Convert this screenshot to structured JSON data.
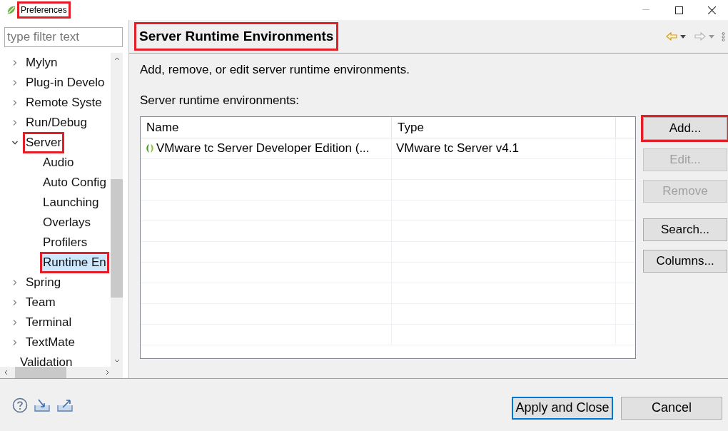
{
  "window": {
    "title": "Preferences",
    "highlighted": true
  },
  "filter": {
    "placeholder": "type filter text"
  },
  "tree": [
    {
      "label": "Mylyn",
      "expanded": false,
      "selected": false,
      "highlighted": false
    },
    {
      "label": "Plug-in Develo",
      "expanded": false,
      "selected": false,
      "highlighted": false
    },
    {
      "label": "Remote Syste",
      "expanded": false,
      "selected": false,
      "highlighted": false
    },
    {
      "label": "Run/Debug",
      "expanded": false,
      "selected": false,
      "highlighted": false
    },
    {
      "label": "Server",
      "expanded": true,
      "selected": false,
      "highlighted": true,
      "children": [
        {
          "label": "Audio",
          "selected": false,
          "highlighted": false
        },
        {
          "label": "Auto Config",
          "selected": false,
          "highlighted": false
        },
        {
          "label": "Launching",
          "selected": false,
          "highlighted": false
        },
        {
          "label": "Overlays",
          "selected": false,
          "highlighted": false
        },
        {
          "label": "Profilers",
          "selected": false,
          "highlighted": false
        },
        {
          "label": "Runtime En",
          "selected": true,
          "highlighted": true
        }
      ]
    },
    {
      "label": "Spring",
      "expanded": false,
      "selected": false,
      "highlighted": false
    },
    {
      "label": "Team",
      "expanded": false,
      "selected": false,
      "highlighted": false
    },
    {
      "label": "Terminal",
      "expanded": false,
      "selected": false,
      "highlighted": false
    },
    {
      "label": "TextMate",
      "expanded": false,
      "selected": false,
      "highlighted": false
    },
    {
      "label": "Validation",
      "selected": false,
      "highlighted": false
    }
  ],
  "page": {
    "title": "Server Runtime Environments",
    "highlighted": true,
    "description": "Add, remove, or edit server runtime environments.",
    "list_label": "Server runtime environments:"
  },
  "table": {
    "columns": [
      "Name",
      "Type"
    ],
    "rows": [
      [
        "VMware tc Server Developer Edition (...",
        "VMware tc Server v4.1"
      ]
    ]
  },
  "side_buttons": [
    {
      "label": "Add...",
      "disabled": false,
      "highlighted": true
    },
    {
      "label": "Edit...",
      "disabled": true,
      "highlighted": false
    },
    {
      "label": "Remove",
      "disabled": true,
      "highlighted": false
    },
    {
      "label": "Search...",
      "disabled": false,
      "highlighted": false
    },
    {
      "label": "Columns...",
      "disabled": false,
      "highlighted": false
    }
  ],
  "footer_buttons": [
    {
      "label": "Apply and Close",
      "default": true
    },
    {
      "label": "Cancel",
      "default": false
    }
  ]
}
